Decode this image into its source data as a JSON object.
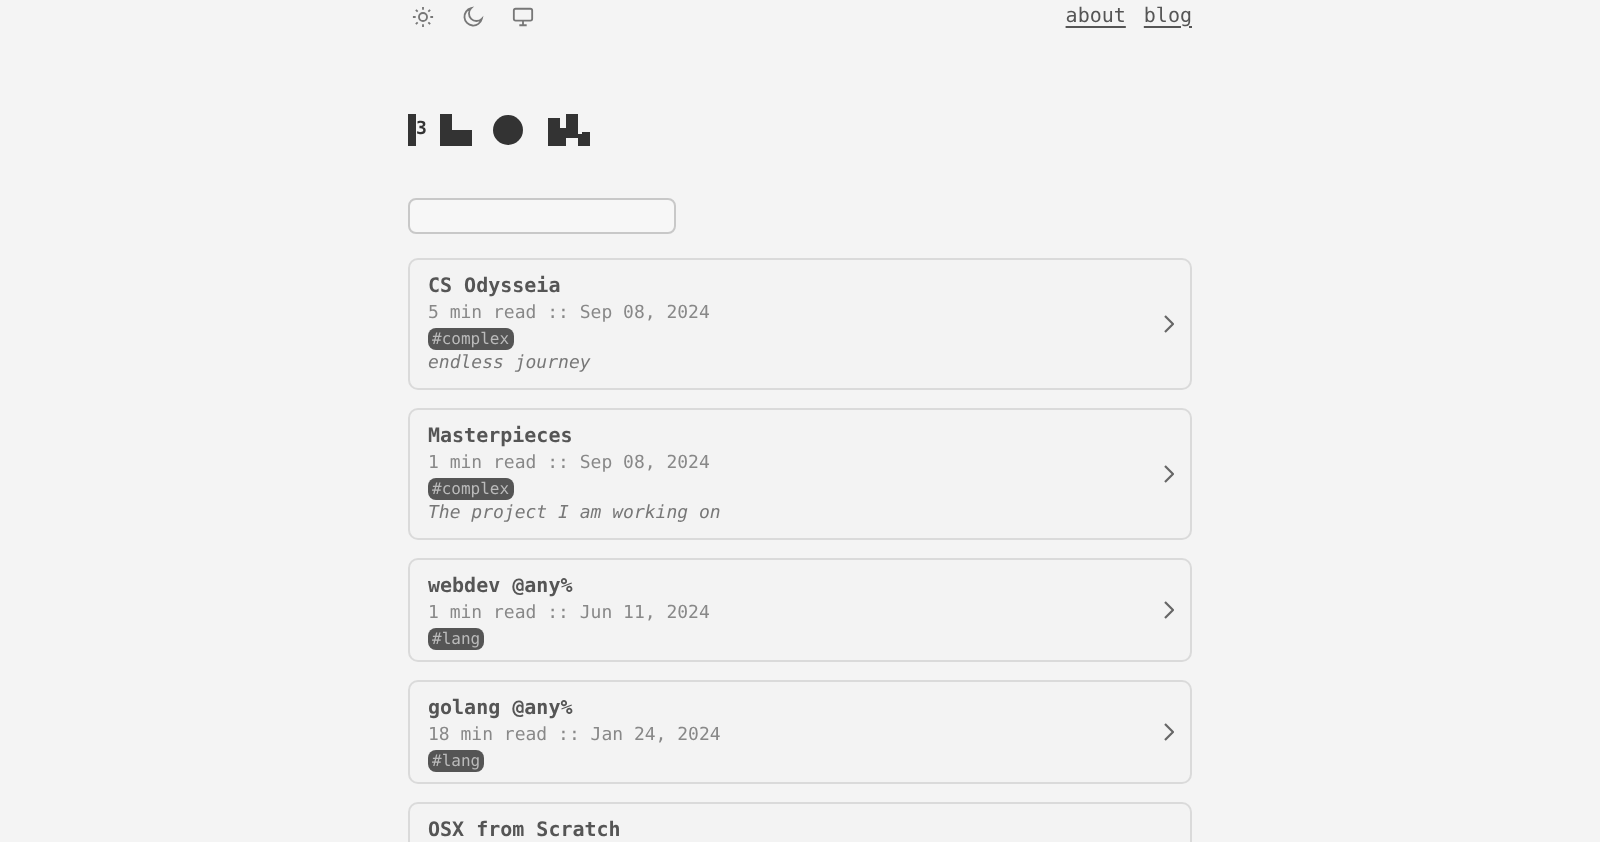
{
  "theme_toggles": [
    {
      "kind": "light"
    },
    {
      "kind": "dark"
    },
    {
      "kind": "system"
    }
  ],
  "nav": [
    "about",
    "blog"
  ],
  "logo": {
    "digit": "3"
  },
  "posts": [
    {
      "title": "CS Odysseia",
      "meta": "5 min read :: Sep 08, 2024",
      "tags": [
        "#complex"
      ],
      "description": "endless journey"
    },
    {
      "title": "Masterpieces",
      "meta": "1 min read :: Sep 08, 2024",
      "tags": [
        "#complex"
      ],
      "description": "The project I am working on"
    },
    {
      "title": "webdev @any%",
      "meta": "1 min read :: Jun 11, 2024",
      "tags": [
        "#lang"
      ]
    },
    {
      "title": "golang @any%",
      "meta": "18 min read :: Jan 24, 2024",
      "tags": [
        "#lang"
      ]
    },
    {
      "title": "OSX from Scratch"
    }
  ]
}
